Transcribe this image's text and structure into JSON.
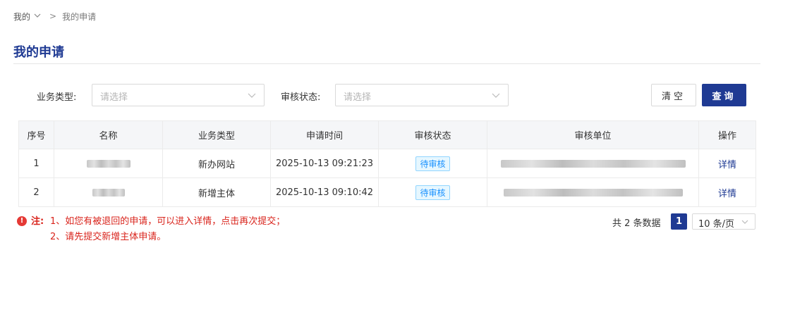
{
  "breadcrumb": {
    "root": "我的",
    "current": "我的申请"
  },
  "page": {
    "title": "我的申请"
  },
  "filters": {
    "business_type": {
      "label": "业务类型:",
      "placeholder": "请选择"
    },
    "review_status": {
      "label": "审核状态:",
      "placeholder": "请选择"
    }
  },
  "buttons": {
    "clear": "清空",
    "query": "查询"
  },
  "table": {
    "columns": [
      "序号",
      "名称",
      "业务类型",
      "申请时间",
      "审核状态",
      "审核单位",
      "操作"
    ],
    "rows": [
      {
        "index": "1",
        "business_type": "新办网站",
        "apply_time": "2025-10-13 09:21:23",
        "status": "待审核",
        "action": "详情"
      },
      {
        "index": "2",
        "business_type": "新增主体",
        "apply_time": "2025-10-13 09:10:42",
        "status": "待审核",
        "action": "详情"
      }
    ]
  },
  "note": {
    "lead": "注:",
    "line1": "1、如您有被退回的申请，可以进入详情，点击再次提交；",
    "line2": "2、请先提交新增主体申请。"
  },
  "pagination": {
    "total_text": "共 2 条数据",
    "current_page": "1",
    "page_size": "10 条/页"
  },
  "colors": {
    "brand": "#1f3a93",
    "note_red": "#d9241c",
    "badge_blue": "#1890ff"
  },
  "icons": {
    "breadcrumb_dropdown": "chevron-down-icon",
    "select_arrow": "chevron-down-icon",
    "note_icon": "exclamation-circle-icon"
  }
}
